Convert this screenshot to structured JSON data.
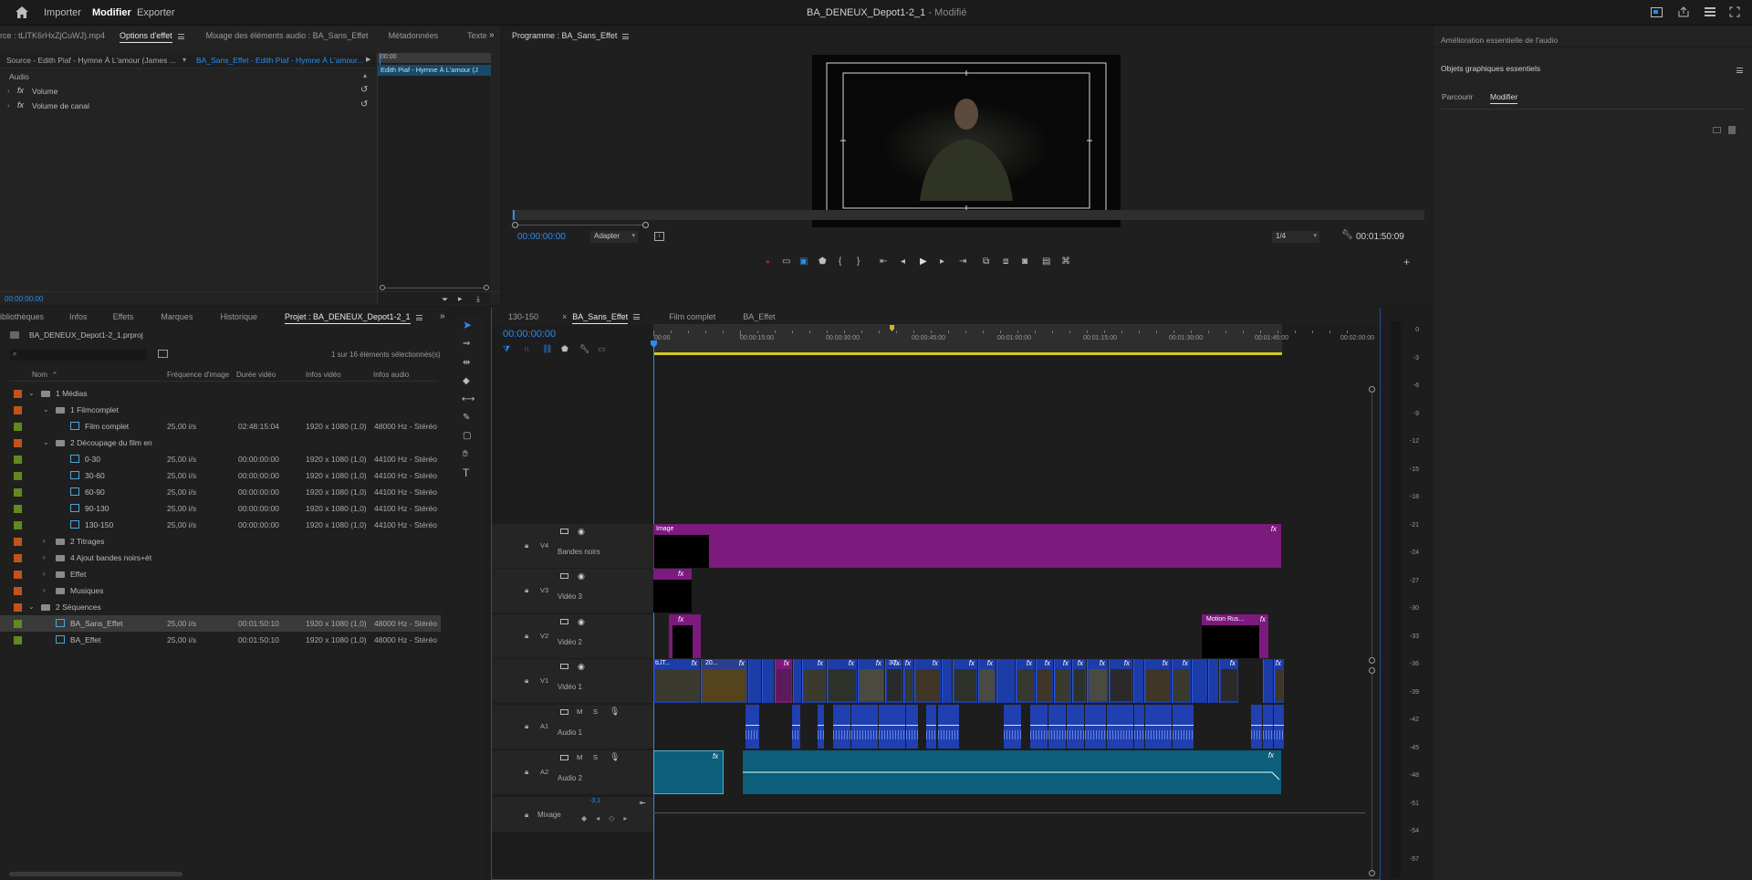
{
  "topbar": {
    "nav": [
      "Importer",
      "Modifier",
      "Exporter"
    ],
    "title": "BA_DENEUX_Depot1-2_1",
    "status": "- Modifié"
  },
  "source_panel": {
    "tabs": [
      "rce : tLlTK6rHxZjCuWJ).mp4",
      "Options d'effet",
      "Mixage des éléments audio : BA_Sans_Effet",
      "Métadonnées",
      "Texte"
    ],
    "source_label": "Source - Edith Piaf - Hymne À L'amour (James ...",
    "sequence_label": "BA_Sans_Effet - Edith Piaf - Hymne À L'amour...",
    "mini_time": "00:00",
    "mini_clip": "Edith Piaf - Hymne À L'amour (J",
    "section": "Audio",
    "effects": [
      "Volume",
      "Volume de canal"
    ],
    "timecode": "00:00:00:00"
  },
  "program_monitor": {
    "title": "Programme : BA_Sans_Effet",
    "timecode": "00:00:00:00",
    "fit": "Adapter",
    "resolution": "1/4",
    "duration": "00:01:50:09"
  },
  "right_panel": {
    "title": "Amélioration essentielle de l'audio",
    "section": "Objets graphiques essentiels",
    "tabs": [
      "Parcourir",
      "Modifier"
    ]
  },
  "project_panel": {
    "tabs": [
      "ibliothèques",
      "Infos",
      "Effets",
      "Marques",
      "Historique",
      "Projet : BA_DENEUX_Depot1-2_1"
    ],
    "file": "BA_DENEUX_Depot1-2_1.prproj",
    "selection": "1 sur 16 éléments sélectionnés(s)",
    "columns": [
      "Nom",
      "Fréquence d'image",
      "Durée vidéo",
      "Infos vidéo",
      "Infos audio"
    ],
    "rows": [
      {
        "indent": 1,
        "type": "folder",
        "open": true,
        "name": "1 Médias",
        "color": "#c0541a"
      },
      {
        "indent": 2,
        "type": "folder",
        "open": true,
        "name": "1 Filmcomplet",
        "color": "#c0541a"
      },
      {
        "indent": 3,
        "type": "clip",
        "name": "Film complet",
        "fps": "25,00 i/s",
        "dur": "02:48:15:04",
        "video": "1920 x 1080 (1,0)",
        "audio": "48000 Hz - Stéréo",
        "color": "#5f8a1e"
      },
      {
        "indent": 2,
        "type": "folder",
        "open": true,
        "name": "2 Découpage du film en",
        "color": "#c0541a"
      },
      {
        "indent": 3,
        "type": "clip",
        "name": "0-30",
        "fps": "25,00 i/s",
        "dur": "00:00:00:00",
        "video": "1920 x 1080 (1,0)",
        "audio": "44100 Hz - Stéréo",
        "color": "#5f8a1e"
      },
      {
        "indent": 3,
        "type": "clip",
        "name": "30-60",
        "fps": "25,00 i/s",
        "dur": "00:00:00:00",
        "video": "1920 x 1080 (1,0)",
        "audio": "44100 Hz - Stéréo",
        "color": "#5f8a1e"
      },
      {
        "indent": 3,
        "type": "clip",
        "name": "60-90",
        "fps": "25,00 i/s",
        "dur": "00:00:00:00",
        "video": "1920 x 1080 (1,0)",
        "audio": "44100 Hz - Stéréo",
        "color": "#5f8a1e"
      },
      {
        "indent": 3,
        "type": "clip",
        "name": "90-130",
        "fps": "25,00 i/s",
        "dur": "00:00:00:00",
        "video": "1920 x 1080 (1,0)",
        "audio": "44100 Hz - Stéréo",
        "color": "#5f8a1e"
      },
      {
        "indent": 3,
        "type": "clip",
        "name": "130-150",
        "fps": "25,00 i/s",
        "dur": "00:00:00:00",
        "video": "1920 x 1080 (1,0)",
        "audio": "44100 Hz - Stéréo",
        "color": "#5f8a1e"
      },
      {
        "indent": 2,
        "type": "folder",
        "open": false,
        "name": "2 Titrages",
        "color": "#c0541a"
      },
      {
        "indent": 2,
        "type": "folder",
        "open": false,
        "name": "4 Ajout bandes noirs+ét",
        "color": "#c0541a"
      },
      {
        "indent": 2,
        "type": "folder",
        "open": false,
        "name": "Effet",
        "color": "#c0541a"
      },
      {
        "indent": 2,
        "type": "folder",
        "open": false,
        "name": "Musiques",
        "color": "#c0541a"
      },
      {
        "indent": 1,
        "type": "folder",
        "open": true,
        "name": "2 Séquences",
        "color": "#c0541a"
      },
      {
        "indent": 2,
        "type": "seq",
        "name": "BA_Sans_Effet",
        "fps": "25,00 i/s",
        "dur": "00:01:50:10",
        "video": "1920 x 1080 (1,0)",
        "audio": "48000 Hz - Stéréo",
        "color": "#5f8a1e",
        "selected": true
      },
      {
        "indent": 2,
        "type": "seq",
        "name": "BA_Effet",
        "fps": "25,00 i/s",
        "dur": "00:01:50:10",
        "video": "1920 x 1080 (1,0)",
        "audio": "48000 Hz - Stéréo",
        "color": "#5f8a1e"
      }
    ]
  },
  "timeline": {
    "tabs": [
      "130-150",
      "BA_Sans_Effet",
      "Film complet",
      "BA_Effet"
    ],
    "timecode": "00:00:00:00",
    "ruler": [
      "00:00",
      "00:00:15:00",
      "00:00:30:00",
      "00:00:45:00",
      "00:01:00:00",
      "00:01:15:00",
      "00:01:30:00",
      "00:01:45:00",
      "00:02:00:00"
    ],
    "tracks": [
      {
        "id": "V4",
        "name": "Bandes noirs"
      },
      {
        "id": "V3",
        "name": "Vidéo 3"
      },
      {
        "id": "V2",
        "name": "Vidéo 2"
      },
      {
        "id": "V1",
        "name": "Vidéo 1"
      },
      {
        "id": "A1",
        "name": "Audio 1"
      },
      {
        "id": "A2",
        "name": "Audio 2"
      }
    ],
    "mix_label": "Mixage",
    "mix_value": "-3,1",
    "clip_labels": {
      "image": "Image",
      "motion": "Motion Rus...",
      "v1a": "tLlT...",
      "v1b": "20...",
      "v1c": "30..."
    },
    "fx": "fx"
  },
  "vu_meter": [
    "0",
    "-3",
    "-6",
    "-9",
    "-12",
    "-15",
    "-18",
    "-21",
    "-24",
    "-27",
    "-30",
    "-33",
    "-36",
    "-39",
    "-42",
    "-45",
    "-48",
    "-51",
    "-54",
    "-57"
  ]
}
